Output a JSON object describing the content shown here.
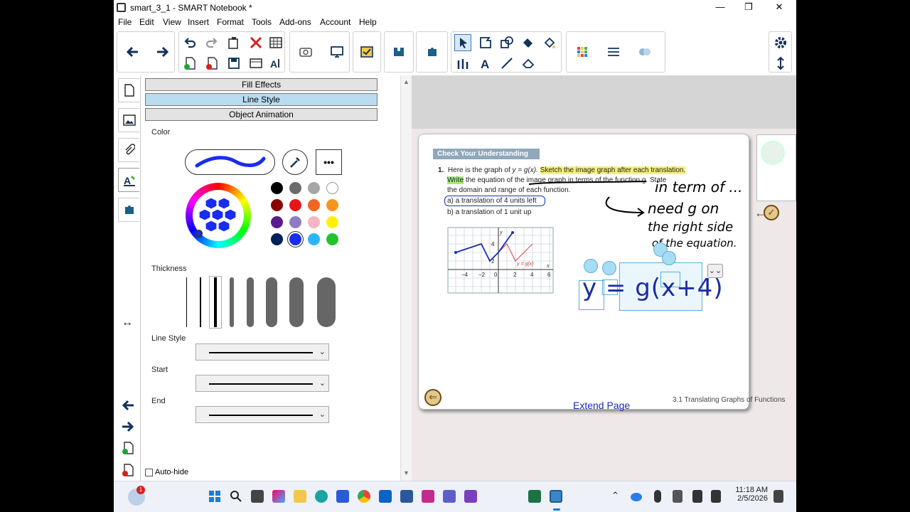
{
  "window": {
    "title": "smart_3_1 - SMART Notebook *",
    "minimize": "—",
    "maximize": "❐",
    "close": "✕"
  },
  "menu": [
    "File",
    "Edit",
    "View",
    "Insert",
    "Format",
    "Tools",
    "Add-ons",
    "Account",
    "Help"
  ],
  "toolbar": {
    "icons": [
      "back-arrow-icon",
      "forward-arrow-icon",
      "undo-icon",
      "redo-icon",
      "paste-icon",
      "delete-icon",
      "table-icon",
      "add-page-icon",
      "delete-page-icon",
      "save-icon",
      "screen-shade-icon",
      "text-recognition-icon",
      "capture-icon",
      "display-icon",
      "response-icon",
      "widget-icon",
      "addon-icon",
      "select-icon",
      "shapes-icon",
      "regular-shapes-icon",
      "fill-icon",
      "pens-icon",
      "text-icon",
      "lines-icon",
      "eraser-icon",
      "properties-icon",
      "align-icon",
      "measurement-tools-icon"
    ]
  },
  "sidetabs": [
    "page-sorter-icon",
    "gallery-icon",
    "attachments-icon",
    "properties-icon",
    "addons-icon"
  ],
  "props": {
    "headers": [
      "Fill Effects",
      "Line Style",
      "Object Animation"
    ],
    "active_header": "Line Style",
    "color_label": "Color",
    "more": "•••",
    "swatches": [
      "#000000",
      "#6b6b6b",
      "#a6a6a6",
      "#ffffff",
      "#8b0000",
      "#e8161b",
      "#f26522",
      "#f7941d",
      "#5b1b8e",
      "#8e7cc3",
      "#f4b6c2",
      "#fff200",
      "#00205b",
      "#1a2cf0",
      "#29b6f6",
      "#22c22c"
    ],
    "selected_swatch": "#1a2cf0",
    "thickness_label": "Thickness",
    "line_style_label": "Line Style",
    "start_label": "Start",
    "end_label": "End",
    "autohide_label": "Auto-hide",
    "resize_arrows": "↔"
  },
  "page": {
    "banner": "Check Your Understanding",
    "q_number": "1.",
    "q_line1_a": "Here is the graph of",
    "q_line1_eq": "y = g(x).",
    "q_line1_b": "Sketch the image graph after each translation.",
    "q_line2_write": "Write",
    "q_line2_rest": "the equation of the image graph in terms of the function g. State",
    "q_line3": "the domain and range of each function.",
    "part_a": "a)  a translation of 4 units left",
    "part_b": "b)  a translation of 1 unit up",
    "graph_label": "y = g(x)",
    "graph_axis_x": "x",
    "graph_axis_y": "y",
    "graph_ticks_x": [
      "−4",
      "−2",
      "0",
      "2",
      "4",
      "6"
    ],
    "graph_ticks_y": [
      "4",
      "2"
    ],
    "handwriting": [
      "in term of ...",
      "need g on",
      "the right side",
      "of the equation."
    ],
    "math": "y = g(x+4)",
    "footer": "3.1 Translating Graphs of Functions",
    "extend": "Extend Page"
  },
  "taskbar": {
    "time": "11:18 AM",
    "date": "2/5/2026",
    "notification_count": "1"
  }
}
